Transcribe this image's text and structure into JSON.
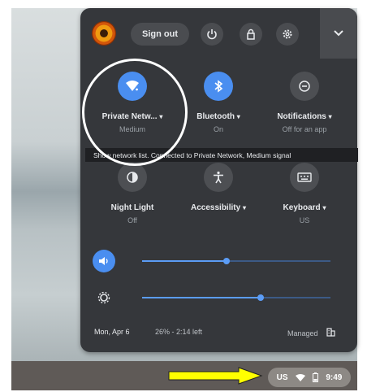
{
  "header": {
    "sign_out_label": "Sign out",
    "buttons": [
      "power-icon",
      "lock-icon",
      "settings-icon",
      "chevron-down-icon"
    ]
  },
  "tiles": [
    {
      "label": "Private Netw...",
      "sub": "Medium",
      "icon": "wifi-icon",
      "active": true,
      "has_caret": true
    },
    {
      "label": "Bluetooth",
      "sub": "On",
      "icon": "bluetooth-icon",
      "active": true,
      "has_caret": true
    },
    {
      "label": "Notifications",
      "sub": "Off for an app",
      "icon": "notifications-off-icon",
      "active": false,
      "has_caret": true
    },
    {
      "label": "Night Light",
      "sub": "Off",
      "icon": "night-light-icon",
      "active": false,
      "has_caret": false
    },
    {
      "label": "Accessibility",
      "sub": "",
      "icon": "accessibility-icon",
      "active": false,
      "has_caret": true
    },
    {
      "label": "Keyboard",
      "sub": "US",
      "icon": "keyboard-icon",
      "active": false,
      "has_caret": true
    }
  ],
  "tooltip": "Show network list. Connected to Private Network, Medium signal",
  "sliders": {
    "volume": {
      "icon": "volume-icon",
      "level": 0.45
    },
    "brightness": {
      "icon": "brightness-icon",
      "level": 0.63
    }
  },
  "footer": {
    "date": "Mon, Apr 6",
    "battery": "26% - 2:14 left",
    "managed": "Managed"
  },
  "shelf": {
    "ime": "US",
    "time": "9:49"
  },
  "colors": {
    "panel": "#35373b",
    "accent": "#4a8ef0",
    "annotation_arrow": "#ffff00"
  }
}
